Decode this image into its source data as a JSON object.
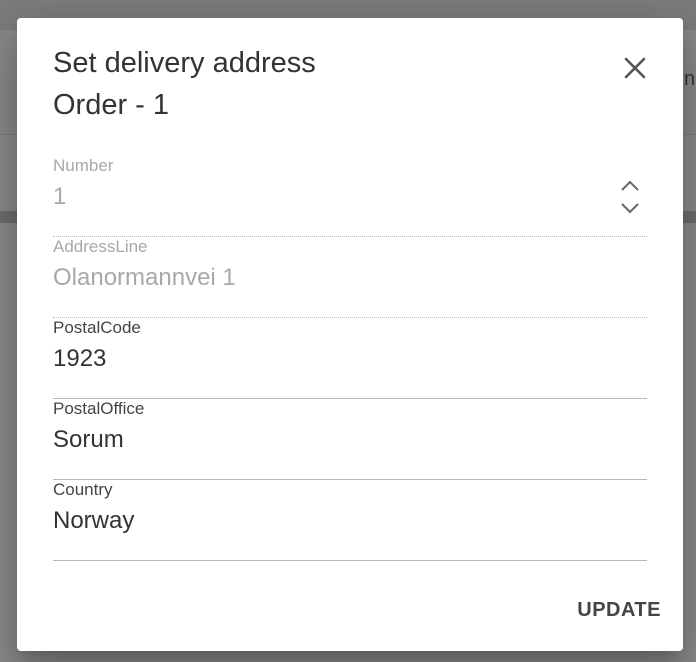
{
  "background": {
    "peek_text": "na"
  },
  "dialog": {
    "title_line1": "Set delivery address",
    "title_line2": "Order - 1",
    "close_icon": "close-icon",
    "fields": [
      {
        "label": "Number",
        "value": "1",
        "disabled": true
      },
      {
        "label": "AddressLine",
        "value": "Olanormannvei 1",
        "disabled": true
      },
      {
        "label": "PostalCode",
        "value": "1923",
        "disabled": false
      },
      {
        "label": "PostalOffice",
        "value": "Sorum",
        "disabled": false
      },
      {
        "label": "Country",
        "value": "Norway",
        "disabled": false
      }
    ],
    "update_label": "UPDATE"
  },
  "colors": {
    "overlay": "#8a8a8a",
    "dialog_bg": "#ffffff",
    "text": "#333333",
    "disabled_text": "#a8a8a8"
  }
}
